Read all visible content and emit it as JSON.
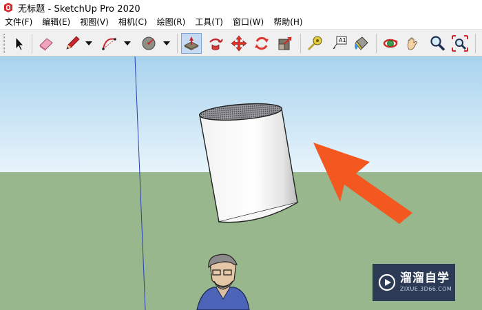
{
  "window": {
    "title": "无标题 - SketchUp Pro 2020"
  },
  "menu": {
    "items": [
      {
        "label": "文件(F)"
      },
      {
        "label": "编辑(E)"
      },
      {
        "label": "视图(V)"
      },
      {
        "label": "相机(C)"
      },
      {
        "label": "绘图(R)"
      },
      {
        "label": "工具(T)"
      },
      {
        "label": "窗口(W)"
      },
      {
        "label": "帮助(H)"
      }
    ]
  },
  "toolbar": {
    "tools": [
      {
        "icon": "select-arrow-icon"
      },
      {
        "icon": "eraser-icon"
      },
      {
        "icon": "pencil-line-icon"
      },
      {
        "icon": "arc-icon"
      },
      {
        "icon": "shape-icon"
      },
      {
        "icon": "push-pull-icon",
        "active": true
      },
      {
        "icon": "follow-me-icon"
      },
      {
        "icon": "move-icon"
      },
      {
        "icon": "rotate-icon"
      },
      {
        "icon": "scale-icon"
      },
      {
        "icon": "tape-measure-icon"
      },
      {
        "icon": "text-icon",
        "text": "A1"
      },
      {
        "icon": "paint-bucket-icon"
      },
      {
        "icon": "orbit-icon"
      },
      {
        "icon": "pan-icon"
      },
      {
        "icon": "zoom-icon"
      },
      {
        "icon": "zoom-extents-icon"
      }
    ]
  },
  "viewport": {
    "sky_color_top": "#a8d3ee",
    "sky_color_bottom": "#e8f4fb",
    "ground_color": "#98b78c",
    "axis_color": "#2b3fb0",
    "arrow_color": "#f2581f"
  },
  "watermark": {
    "brand": "溜溜自学",
    "url": "ZIXUE.3D66.COM"
  }
}
